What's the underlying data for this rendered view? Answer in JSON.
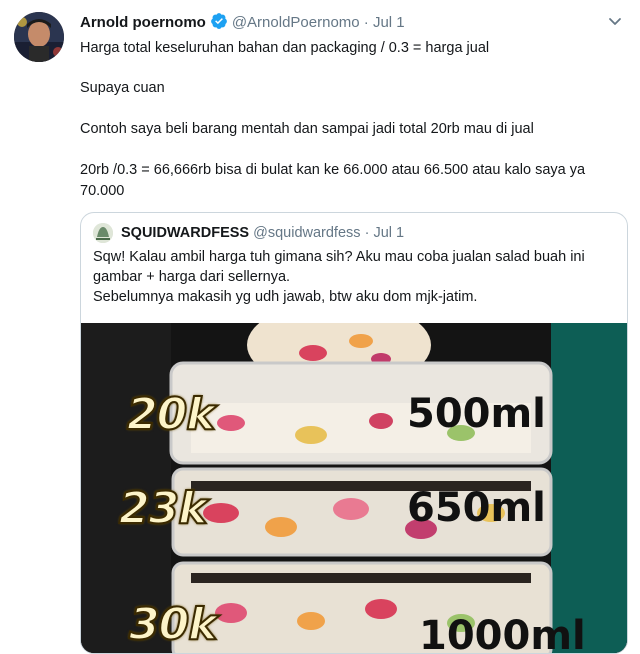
{
  "author": {
    "name": "Arnold poernomo",
    "handle": "@ArnoldPoernomo",
    "separator": "·",
    "date": "Jul 1"
  },
  "tweet": {
    "paragraphs": [
      "Harga total keseluruhan bahan dan packaging / 0.3 = harga jual",
      "Supaya cuan",
      "Contoh saya beli barang mentah dan sampai jadi total 20rb mau di jual",
      "20rb /0.3 = 66,666rb bisa di bulat kan ke 66.000 atau 66.500 atau kalo saya ya 70.000"
    ]
  },
  "quoted": {
    "name": "SQUIDWARDFESS",
    "handle": "@squidwardfess",
    "separator": "·",
    "date": "Jul 1",
    "lines": [
      "Sqw! Kalau ambil harga tuh gimana sih? Aku mau coba jualan salad buah ini gambar + harga dari sellernya.",
      "Sebelumnya makasih yg udh jawab, btw aku dom mjk-jatim."
    ],
    "media": {
      "rows": [
        {
          "price": "20k",
          "volume": "500ml"
        },
        {
          "price": "23k",
          "volume": "650ml"
        },
        {
          "price": "30k",
          "volume": "1000ml"
        }
      ]
    }
  },
  "colors": {
    "text": "#14171a",
    "muted": "#657786",
    "verified": "#1da1f2",
    "border": "#ccd6dd"
  },
  "icons": {
    "verified": "verified-badge-icon",
    "menu": "chevron-down-icon"
  }
}
